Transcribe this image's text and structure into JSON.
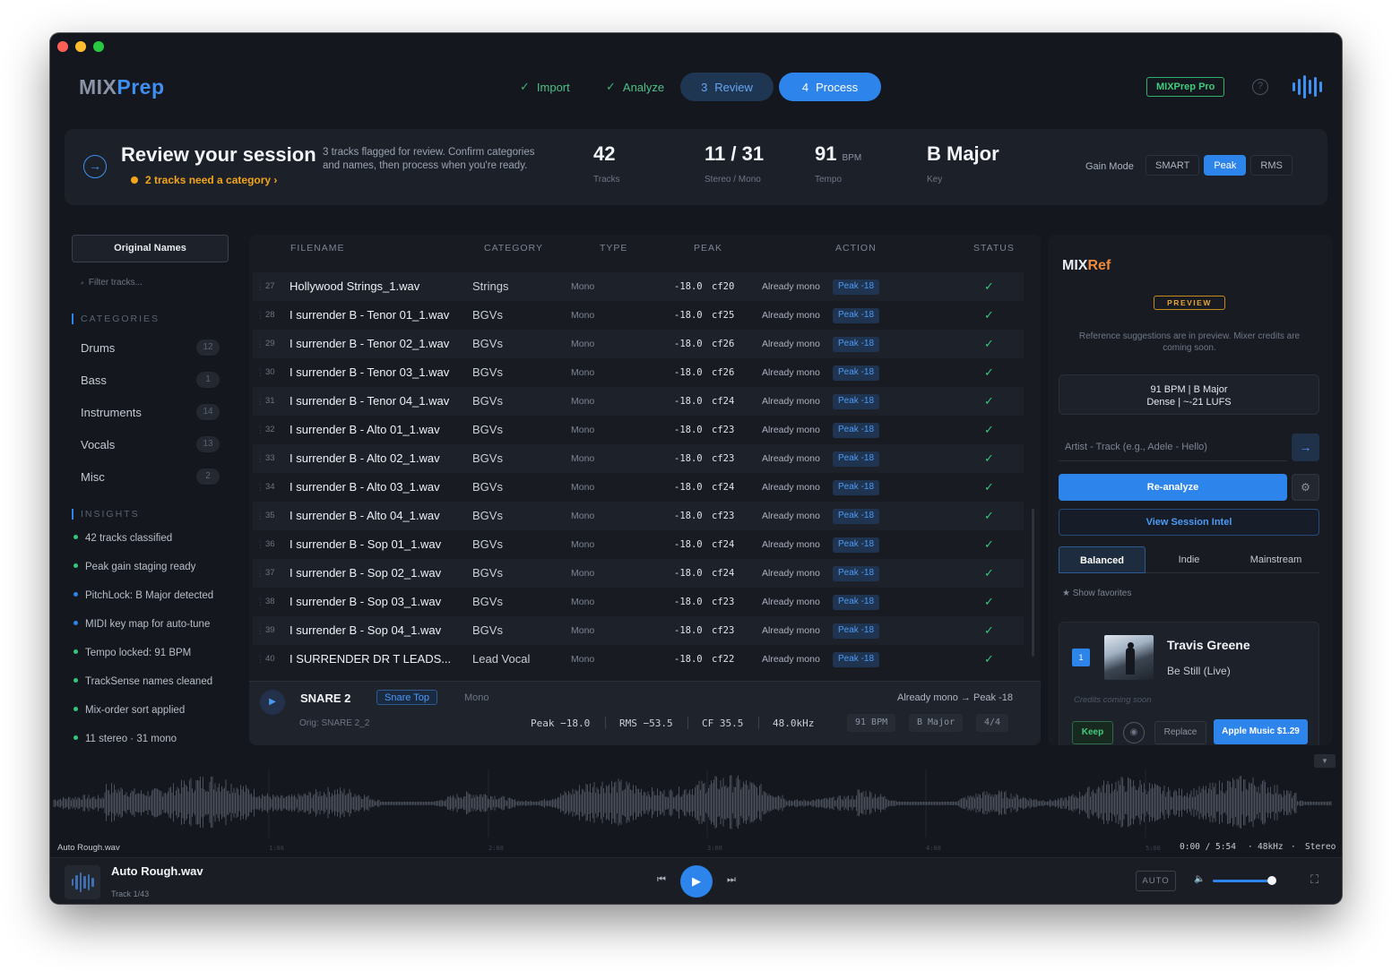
{
  "app": {
    "logo_a": "MIX",
    "logo_b": "Prep",
    "pro_badge": "MIXPrep Pro",
    "help_glyph": "?"
  },
  "steps": [
    {
      "prefix": "✓",
      "label": "Import",
      "state": "done"
    },
    {
      "prefix": "✓",
      "label": "Analyze",
      "state": "done"
    },
    {
      "prefix": "3",
      "label": "Review",
      "state": "current"
    },
    {
      "prefix": "4",
      "label": "Process",
      "state": "next"
    }
  ],
  "summary": {
    "title": "Review your session",
    "flag": "2 tracks need a category  ›",
    "description": "3 tracks flagged for review. Confirm categories and names, then process when you're ready.",
    "stats": [
      {
        "value": "42",
        "unit": "",
        "label": "Tracks"
      },
      {
        "value": "11 / 31",
        "unit": "",
        "label": "Stereo / Mono"
      },
      {
        "value": "91",
        "unit": "BPM",
        "label": "Tempo"
      },
      {
        "value": "B Major",
        "unit": "",
        "label": "Key"
      }
    ],
    "gain_mode_label": "Gain Mode",
    "gain_modes": [
      "SMART",
      "Peak",
      "RMS"
    ],
    "gain_mode_selected": "Peak"
  },
  "sidebar": {
    "names_button": "Original Names",
    "filter_placeholder": "Filter tracks...",
    "categories_heading": "CATEGORIES",
    "categories": [
      {
        "label": "Drums",
        "count": "12"
      },
      {
        "label": "Bass",
        "count": "1"
      },
      {
        "label": "Instruments",
        "count": "14"
      },
      {
        "label": "Vocals",
        "count": "13"
      },
      {
        "label": "Misc",
        "count": "2"
      }
    ],
    "insights_heading": "INSIGHTS",
    "insights": [
      {
        "text": "42 tracks classified",
        "color": "#35c777"
      },
      {
        "text": "Peak gain staging ready",
        "color": "#35c777"
      },
      {
        "text": "PitchLock: B Major detected",
        "color": "#2d84ea"
      },
      {
        "text": "MIDI key map for auto-tune",
        "color": "#2d84ea"
      },
      {
        "text": "Tempo locked: 91 BPM",
        "color": "#35c777"
      },
      {
        "text": "TrackSense names cleaned",
        "color": "#35c777"
      },
      {
        "text": "Mix-order sort applied",
        "color": "#35c777"
      },
      {
        "text": "11 stereo · 31 mono",
        "color": "#35c777"
      }
    ]
  },
  "table": {
    "headers": {
      "filename": "FILENAME",
      "category": "CATEGORY",
      "type": "TYPE",
      "peak": "PEAK",
      "action": "ACTION",
      "status": "STATUS"
    },
    "rows": [
      {
        "num": "27",
        "file": "Hollywood Strings_1.wav",
        "category": "Strings",
        "type": "Mono",
        "peak": "-18.0",
        "cf": "cf20",
        "action": "Already mono",
        "badge": "Peak -18",
        "status": "✓"
      },
      {
        "num": "28",
        "file": "I surrender B - Tenor 01_1.wav",
        "category": "BGVs",
        "type": "Mono",
        "peak": "-18.0",
        "cf": "cf25",
        "action": "Already mono",
        "badge": "Peak -18",
        "status": "✓"
      },
      {
        "num": "29",
        "file": "I surrender B - Tenor 02_1.wav",
        "category": "BGVs",
        "type": "Mono",
        "peak": "-18.0",
        "cf": "cf26",
        "action": "Already mono",
        "badge": "Peak -18",
        "status": "✓"
      },
      {
        "num": "30",
        "file": "I surrender B - Tenor 03_1.wav",
        "category": "BGVs",
        "type": "Mono",
        "peak": "-18.0",
        "cf": "cf26",
        "action": "Already mono",
        "badge": "Peak -18",
        "status": "✓"
      },
      {
        "num": "31",
        "file": "I surrender B - Tenor 04_1.wav",
        "category": "BGVs",
        "type": "Mono",
        "peak": "-18.0",
        "cf": "cf24",
        "action": "Already mono",
        "badge": "Peak -18",
        "status": "✓"
      },
      {
        "num": "32",
        "file": "I surrender B - Alto 01_1.wav",
        "category": "BGVs",
        "type": "Mono",
        "peak": "-18.0",
        "cf": "cf23",
        "action": "Already mono",
        "badge": "Peak -18",
        "status": "✓"
      },
      {
        "num": "33",
        "file": "I surrender B - Alto 02_1.wav",
        "category": "BGVs",
        "type": "Mono",
        "peak": "-18.0",
        "cf": "cf23",
        "action": "Already mono",
        "badge": "Peak -18",
        "status": "✓"
      },
      {
        "num": "34",
        "file": "I surrender B - Alto 03_1.wav",
        "category": "BGVs",
        "type": "Mono",
        "peak": "-18.0",
        "cf": "cf24",
        "action": "Already mono",
        "badge": "Peak -18",
        "status": "✓"
      },
      {
        "num": "35",
        "file": "I surrender B - Alto 04_1.wav",
        "category": "BGVs",
        "type": "Mono",
        "peak": "-18.0",
        "cf": "cf23",
        "action": "Already mono",
        "badge": "Peak -18",
        "status": "✓"
      },
      {
        "num": "36",
        "file": "I surrender B - Sop 01_1.wav",
        "category": "BGVs",
        "type": "Mono",
        "peak": "-18.0",
        "cf": "cf24",
        "action": "Already mono",
        "badge": "Peak -18",
        "status": "✓"
      },
      {
        "num": "37",
        "file": "I surrender B - Sop 02_1.wav",
        "category": "BGVs",
        "type": "Mono",
        "peak": "-18.0",
        "cf": "cf24",
        "action": "Already mono",
        "badge": "Peak -18",
        "status": "✓"
      },
      {
        "num": "38",
        "file": "I surrender B - Sop 03_1.wav",
        "category": "BGVs",
        "type": "Mono",
        "peak": "-18.0",
        "cf": "cf23",
        "action": "Already mono",
        "badge": "Peak -18",
        "status": "✓"
      },
      {
        "num": "39",
        "file": "I surrender B - Sop 04_1.wav",
        "category": "BGVs",
        "type": "Mono",
        "peak": "-18.0",
        "cf": "cf23",
        "action": "Already mono",
        "badge": "Peak -18",
        "status": "✓"
      },
      {
        "num": "40",
        "file": "I SURRENDER DR T LEADS...",
        "category": "Lead Vocal",
        "type": "Mono",
        "peak": "-18.0",
        "cf": "cf22",
        "action": "Already mono",
        "badge": "Peak -18",
        "status": "✓"
      }
    ]
  },
  "detail": {
    "play_glyph": "▶",
    "name": "SNARE 2",
    "category": "Snare Top",
    "type": "Mono",
    "action": "Already mono  →  Peak -18",
    "orig": "Orig: SNARE 2_2",
    "peak": "Peak −18.0",
    "rms": "RMS −53.5",
    "cf": "CF 35.5",
    "rate": "48.0kHz",
    "chips": [
      "91 BPM",
      "B Major",
      "4/4"
    ]
  },
  "mixref": {
    "logo_a": "MIX",
    "logo_b": "Ref",
    "badge": "PREVIEW",
    "note": "Reference suggestions are in preview. Mixer credits are coming soon.",
    "box_line1": "91 BPM  |  B Major",
    "box_line2": "Dense  |  ~-21 LUFS",
    "input_placeholder": "Artist - Track (e.g., Adele - Hello)",
    "go_glyph": "→",
    "reanalyze": "Re-analyze",
    "gear_glyph": "⚙",
    "intel": "View Session Intel",
    "modes": [
      "Balanced",
      "Indie",
      "Mainstream"
    ],
    "mode_selected": "Balanced",
    "favorites": "★ Show favorites",
    "card": {
      "rank": "1",
      "artist": "Travis Greene",
      "song": "Be Still (Live)",
      "credits": "Credits coming soon",
      "keep": "Keep",
      "listen_glyph": "◉",
      "replace": "Replace",
      "apple": "Apple Music $1.29"
    }
  },
  "waveform": {
    "collapse_glyph": "▼",
    "filename": "Auto Rough.wav",
    "ticks": [
      "1:00",
      "2:00",
      "3:00",
      "4:00",
      "5:00"
    ],
    "time": "0:00 / 5:54",
    "rate": "48kHz",
    "channels": "Stereo",
    "dot": "·"
  },
  "player": {
    "title": "Auto Rough.wav",
    "subtitle": "Track 1/43",
    "prev_glyph": "⏮",
    "play_glyph": "▶",
    "next_glyph": "⏭",
    "auto": "AUTO",
    "volume_glyph": "🔈",
    "volume_level": 0.94,
    "fullscreen_glyph": "⛶"
  }
}
